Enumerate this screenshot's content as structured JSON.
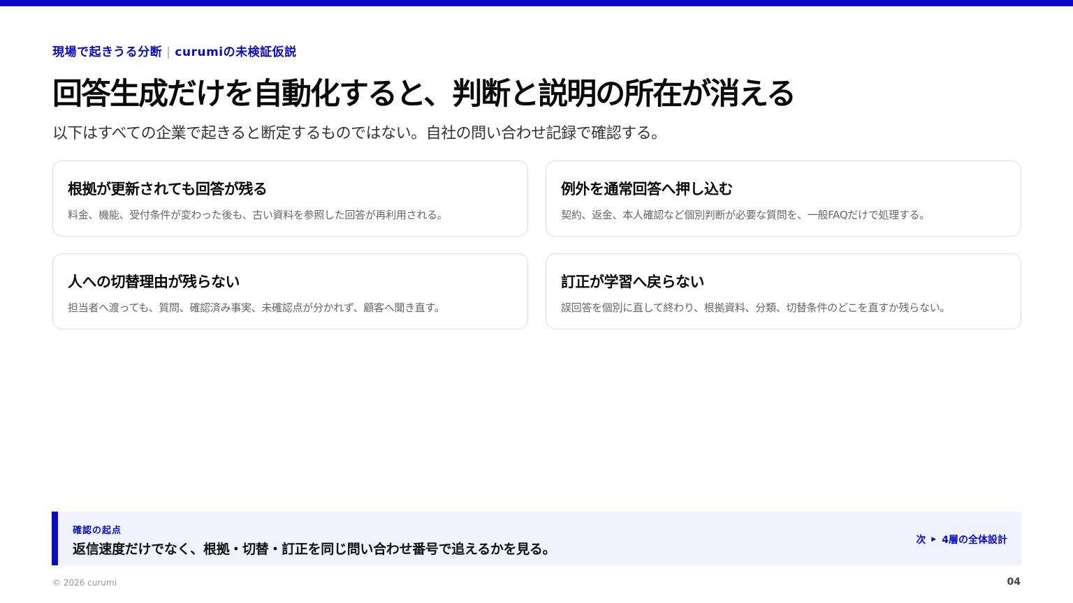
{
  "header": {
    "eyebrow_left": "現場で起きうる分断",
    "eyebrow_separator": "|",
    "eyebrow_right": "curumiの未検証仮説",
    "title": "回答生成だけを自動化すると、判断と説明の所在が消える",
    "subtitle": "以下はすべての企業で起きると断定するものではない。自社の問い合わせ記録で確認する。"
  },
  "cards": [
    {
      "title": "根拠が更新されても回答が残る",
      "body": "料金、機能、受付条件が変わった後も、古い資料を参照した回答が再利用される。"
    },
    {
      "title": "例外を通常回答へ押し込む",
      "body": "契約、返金、本人確認など個別判断が必要な質問を、一般FAQだけで処理する。"
    },
    {
      "title": "人への切替理由が残らない",
      "body": "担当者へ渡っても、質問、確認済み事実、未確認点が分かれず、顧客へ聞き直す。"
    },
    {
      "title": "訂正が学習へ戻らない",
      "body": "誤回答を個別に直して終わり、根拠資料、分類、切替条件のどこを直すか残らない。"
    }
  ],
  "callout": {
    "label": "確認の起点",
    "text": "返信速度だけでなく、根拠・切替・訂正を同じ問い合わせ番号で追えるかを見る。",
    "next_prefix": "次",
    "next_arrow": "▶",
    "next_label": "4層の全体設計"
  },
  "footer": {
    "copyright": "© 2026 curumi",
    "page_number": "04"
  },
  "colors": {
    "accent": "#0a0ac8",
    "callout_bg": "#f0f3fd",
    "card_border": "#dcdce3"
  }
}
